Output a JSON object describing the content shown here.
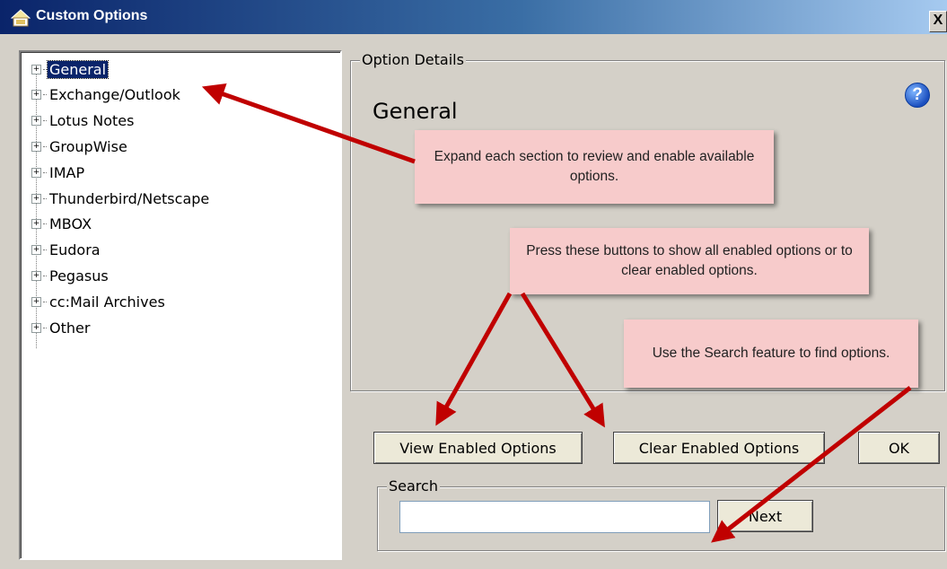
{
  "window": {
    "title": "Custom Options",
    "close_glyph": "X"
  },
  "tree": {
    "items": [
      {
        "label": "General",
        "selected": true,
        "expander": "+"
      },
      {
        "label": "Exchange/Outlook",
        "expander": "+"
      },
      {
        "label": "Lotus Notes",
        "expander": "+"
      },
      {
        "label": "GroupWise",
        "expander": "+"
      },
      {
        "label": "IMAP",
        "expander": "+"
      },
      {
        "label": "Thunderbird/Netscape",
        "expander": "+"
      },
      {
        "label": "MBOX",
        "expander": "+"
      },
      {
        "label": "Eudora",
        "expander": "+"
      },
      {
        "label": "Pegasus",
        "expander": "+"
      },
      {
        "label": "cc:Mail Archives",
        "expander": "+"
      },
      {
        "label": "Other",
        "expander": "+"
      }
    ]
  },
  "details": {
    "group_label": "Option Details",
    "title": "General",
    "help_glyph": "?"
  },
  "buttons": {
    "view_enabled": "View Enabled Options",
    "clear_enabled": "Clear Enabled Options",
    "ok": "OK"
  },
  "search": {
    "group_label": "Search",
    "value": "",
    "next": "Next"
  },
  "callouts": {
    "expand": "Expand each section to review and enable available options.",
    "buttons": "Press these buttons to show all enabled options or to clear enabled options.",
    "search": "Use the Search feature to find options."
  },
  "colors": {
    "arrow": "#c00000",
    "callout_bg": "#f7cbcb",
    "selection": "#0a246a",
    "dialog_bg": "#d4d0c8"
  }
}
